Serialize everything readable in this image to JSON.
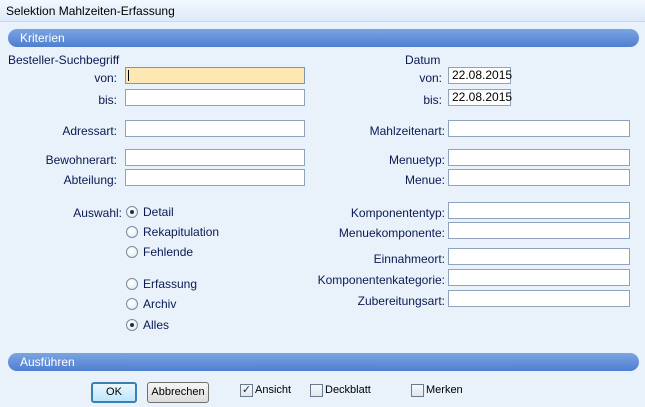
{
  "window": {
    "title": "Selektion Mahlzeiten-Erfassung"
  },
  "sections": {
    "criteria": "Kriterien",
    "execute": "Ausführen"
  },
  "left": {
    "besteller_heading": "Besteller-Suchbegriff",
    "von_label": "von:",
    "von_value": "",
    "bis_label": "bis:",
    "bis_value": "",
    "adressart_label": "Adressart:",
    "adressart_value": "",
    "bewohnerart_label": "Bewohnerart:",
    "bewohnerart_value": "",
    "abteilung_label": "Abteilung:",
    "abteilung_value": "",
    "auswahl_label": "Auswahl:",
    "radio_group1": [
      {
        "label": "Detail",
        "checked": true
      },
      {
        "label": "Rekapitulation",
        "checked": false
      },
      {
        "label": "Fehlende",
        "checked": false
      }
    ],
    "radio_group2": [
      {
        "label": "Erfassung",
        "checked": false
      },
      {
        "label": "Archiv",
        "checked": false
      },
      {
        "label": "Alles",
        "checked": true
      }
    ]
  },
  "right": {
    "datum_heading": "Datum",
    "von_label": "von:",
    "von_value": "22.08.2015",
    "bis_label": "bis:",
    "bis_value": "22.08.2015",
    "mahlzeitenart_label": "Mahlzeitenart:",
    "menuetyp_label": "Menuetyp:",
    "menue_label": "Menue:",
    "komponententyp_label": "Komponententyp:",
    "menuekomponente_label": "Menuekomponente:",
    "einnahmeort_label": "Einnahmeort:",
    "komponentenkategorie_label": "Komponentenkategorie:",
    "zubereitungsart_label": "Zubereitungsart:"
  },
  "footer": {
    "ok_label": "OK",
    "cancel_label": "Abbrechen",
    "checkboxes": [
      {
        "label": "Ansicht",
        "checked": true
      },
      {
        "label": "Deckblatt",
        "checked": false
      },
      {
        "label": "Merken",
        "checked": false
      }
    ]
  },
  "colors": {
    "background": "#e9f1fb",
    "section_bar": "#5b89d6",
    "focus_field": "#fde8b3",
    "label_text": "#0a1a52"
  }
}
